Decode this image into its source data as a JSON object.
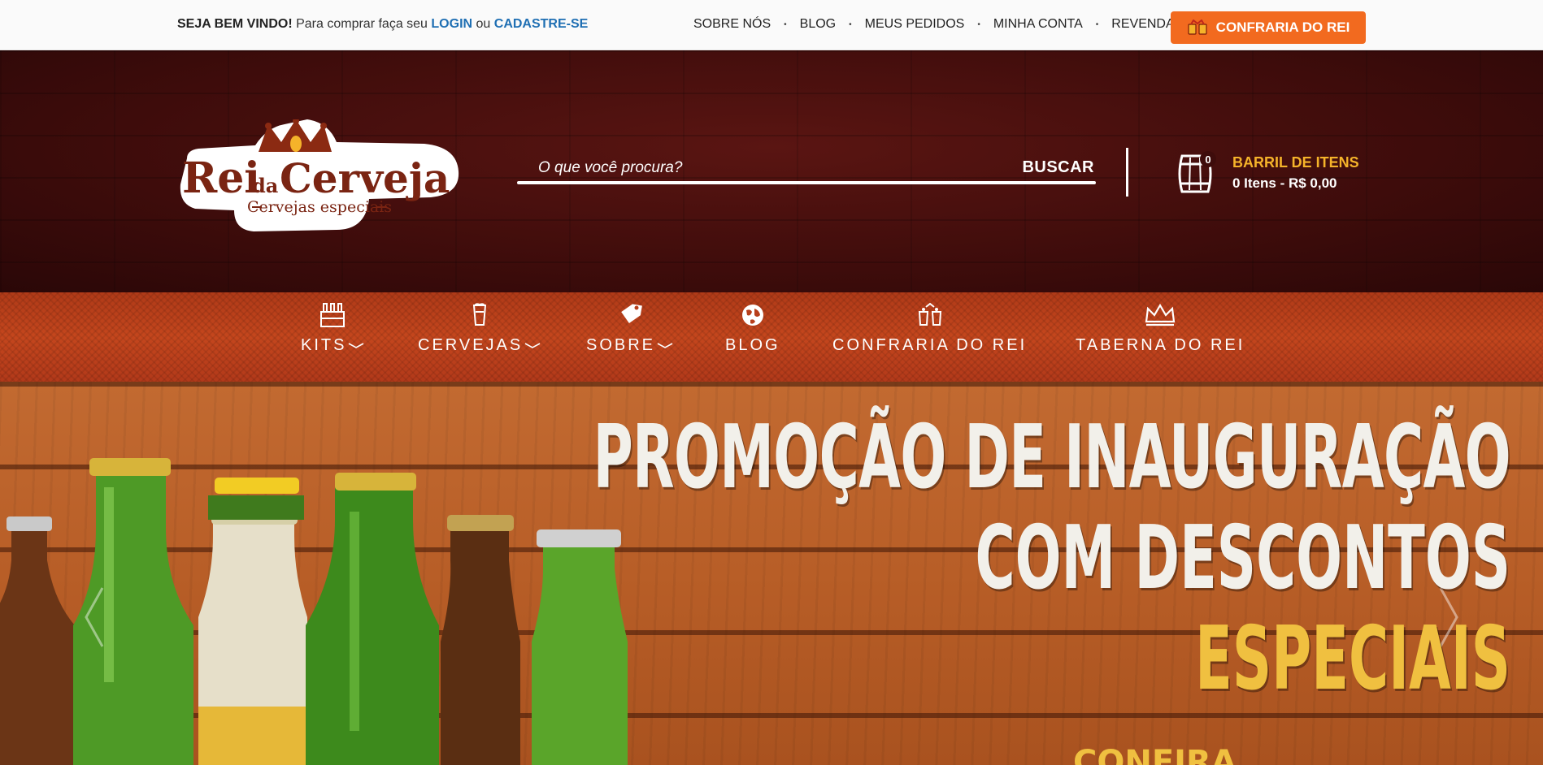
{
  "topbar": {
    "welcome_bold": "SEJA BEM VINDO!",
    "welcome_text": " Para comprar faça seu ",
    "login_label": "LOGIN",
    "or_text": " ou ",
    "register_label": "CADASTRE-SE",
    "links": [
      "SOBRE NÓS",
      "BLOG",
      "MEUS PEDIDOS",
      "MINHA CONTA",
      "REVENDA"
    ],
    "separator": "•",
    "confraria_button": "CONFRARIA DO REI"
  },
  "header": {
    "logo_text_1": "Rei",
    "logo_text_2": "da",
    "logo_text_3": "Cerveja",
    "logo_tagline": "Cervejas especiais",
    "search_placeholder": "O que você procura?",
    "search_button": "BUSCAR",
    "cart": {
      "title": "BARRIL DE ITENS",
      "info": "0 Itens - R$ 0,00",
      "badge_count": "0"
    }
  },
  "mainnav": {
    "items": [
      {
        "label": "KITS",
        "icon": "beer-crate-icon",
        "dropdown": true
      },
      {
        "label": "CERVEJAS",
        "icon": "beer-glass-icon",
        "dropdown": true
      },
      {
        "label": "SOBRE",
        "icon": "tag-icon",
        "dropdown": true
      },
      {
        "label": "BLOG",
        "icon": "globe-icon",
        "dropdown": false
      },
      {
        "label": "CONFRARIA DO REI",
        "icon": "toast-icon",
        "dropdown": false
      },
      {
        "label": "TABERNA DO REI",
        "icon": "crown-icon",
        "dropdown": false
      }
    ]
  },
  "hero": {
    "line1": "PROMOÇÃO DE INAUGURAÇÃO",
    "line2": "COM DESCONTOS",
    "line3": "ESPECIAIS",
    "cta": "CONFIRA"
  },
  "colors": {
    "accent_orange": "#f26a1f",
    "header_dark": "#3e0c0b",
    "nav_red": "#b83f1b",
    "gold": "#f5b32a",
    "link_blue": "#1f6fb3"
  }
}
